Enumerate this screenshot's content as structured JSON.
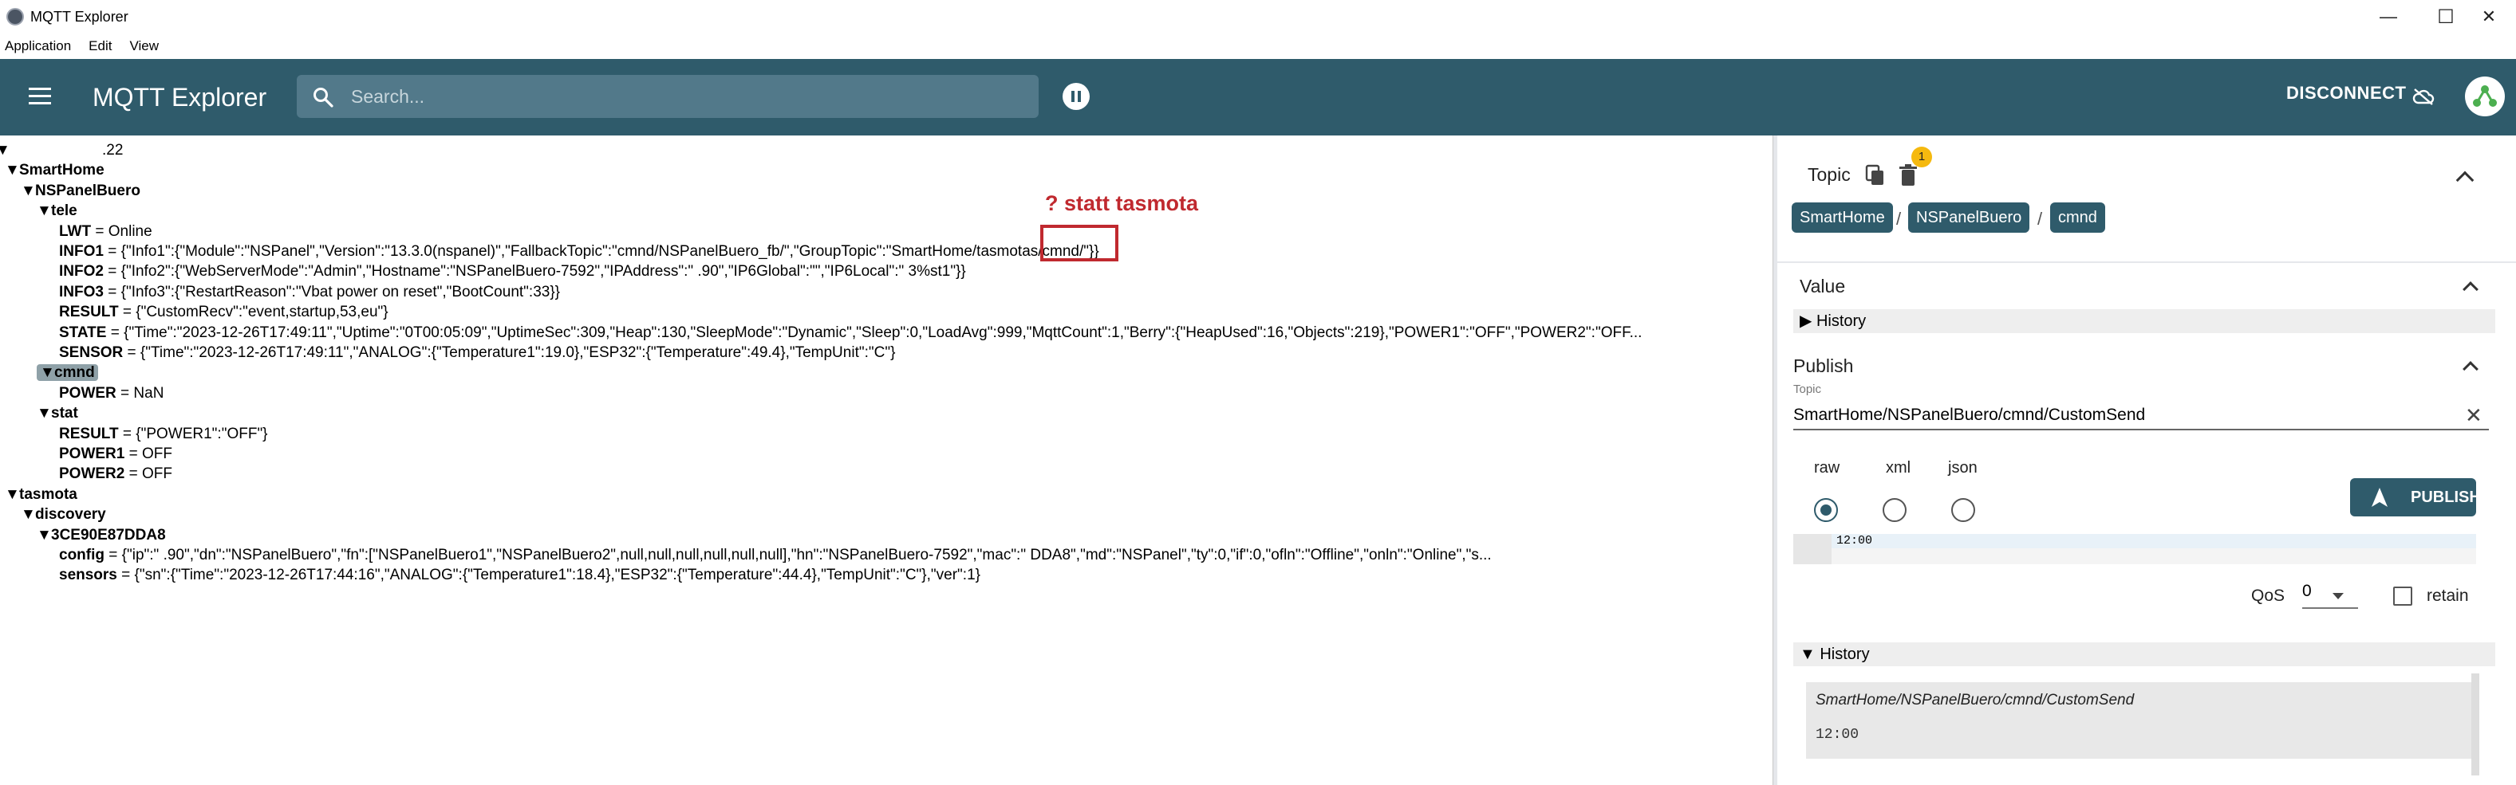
{
  "window": {
    "title": "MQTT Explorer",
    "minimize_glyph": "—",
    "maximize_glyph": "☐",
    "close_glyph": "✕"
  },
  "menu": [
    "Application",
    "Edit",
    "View"
  ],
  "header": {
    "title": "MQTT Explorer",
    "search_placeholder": "Search...",
    "disconnect_label": "DISCONNECT"
  },
  "tree": {
    "root_suffix": ".22",
    "rows": [
      {
        "indent": 0,
        "expand": "▼",
        "key": "",
        "value": ".22",
        "redact_before": true
      },
      {
        "indent": 1,
        "expand": "▼",
        "key": "SmartHome",
        "value": ""
      },
      {
        "indent": 2,
        "expand": "▼",
        "key": "NSPanelBuero",
        "value": ""
      },
      {
        "indent": 3,
        "expand": "▼",
        "key": "tele",
        "value": ""
      },
      {
        "indent": 4,
        "expand": "",
        "key": "LWT",
        "value": " = Online"
      },
      {
        "indent": 4,
        "expand": "",
        "key": "INFO1",
        "value": " = {\"Info1\":{\"Module\":\"NSPanel\",\"Version\":\"13.3.0(nspanel)\",\"FallbackTopic\":\"cmnd/NSPanelBuero_fb/\",\"GroupTopic\":\"SmartHome/tasmotas/cmnd/\"}}"
      },
      {
        "indent": 4,
        "expand": "",
        "key": "INFO2",
        "value": " = {\"Info2\":{\"WebServerMode\":\"Admin\",\"Hostname\":\"NSPanelBuero-7592\",\"IPAddress\":\"                    .90\",\"IP6Global\":\"\",\"IP6Local\":\"                                    3%st1\"}}"
      },
      {
        "indent": 4,
        "expand": "",
        "key": "INFO3",
        "value": " = {\"Info3\":{\"RestartReason\":\"Vbat power on reset\",\"BootCount\":33}}"
      },
      {
        "indent": 4,
        "expand": "",
        "key": "RESULT",
        "value": " = {\"CustomRecv\":\"event,startup,53,eu\"}"
      },
      {
        "indent": 4,
        "expand": "",
        "key": "STATE",
        "value": " = {\"Time\":\"2023-12-26T17:49:11\",\"Uptime\":\"0T00:05:09\",\"UptimeSec\":309,\"Heap\":130,\"SleepMode\":\"Dynamic\",\"Sleep\":0,\"LoadAvg\":999,\"MqttCount\":1,\"Berry\":{\"HeapUsed\":16,\"Objects\":219},\"POWER1\":\"OFF\",\"POWER2\":\"OFF..."
      },
      {
        "indent": 4,
        "expand": "",
        "key": "SENSOR",
        "value": " = {\"Time\":\"2023-12-26T17:49:11\",\"ANALOG\":{\"Temperature1\":19.0},\"ESP32\":{\"Temperature\":49.4},\"TempUnit\":\"C\"}"
      },
      {
        "indent": 3,
        "expand": "▼",
        "key": "cmnd",
        "value": "",
        "selected": true
      },
      {
        "indent": 4,
        "expand": "",
        "key": "POWER",
        "value": " = NaN"
      },
      {
        "indent": 3,
        "expand": "▼",
        "key": "stat",
        "value": ""
      },
      {
        "indent": 4,
        "expand": "",
        "key": "RESULT",
        "value": " = {\"POWER1\":\"OFF\"}"
      },
      {
        "indent": 4,
        "expand": "",
        "key": "POWER1",
        "value": " = OFF"
      },
      {
        "indent": 4,
        "expand": "",
        "key": "POWER2",
        "value": " = OFF"
      },
      {
        "indent": 1,
        "expand": "▼",
        "key": "tasmota",
        "value": ""
      },
      {
        "indent": 2,
        "expand": "▼",
        "key": "discovery",
        "value": ""
      },
      {
        "indent": 3,
        "expand": "▼",
        "key": "3CE90E87DDA8",
        "value": ""
      },
      {
        "indent": 4,
        "expand": "",
        "key": "config",
        "value": " = {\"ip\":\"                    .90\",\"dn\":\"NSPanelBuero\",\"fn\":[\"NSPanelBuero1\",\"NSPanelBuero2\",null,null,null,null,null,null],\"hn\":\"NSPanelBuero-7592\",\"mac\":\"                 DDA8\",\"md\":\"NSPanel\",\"ty\":0,\"if\":0,\"ofln\":\"Offline\",\"onln\":\"Online\",\"s..."
      },
      {
        "indent": 4,
        "expand": "",
        "key": "sensors",
        "value": " = {\"sn\":{\"Time\":\"2023-12-26T17:44:16\",\"ANALOG\":{\"Temperature1\":18.4},\"ESP32\":{\"Temperature\":44.4},\"TempUnit\":\"C\"},\"ver\":1}"
      }
    ]
  },
  "annotation": {
    "text": "? statt tasmota"
  },
  "topic_panel": {
    "title": "Topic",
    "badge_count": "1",
    "breadcrumb": [
      "SmartHome",
      "NSPanelBuero",
      "cmnd"
    ],
    "separator": "/"
  },
  "value_panel": {
    "title": "Value",
    "history_label": "History",
    "history_expand": "▶"
  },
  "publish_panel": {
    "title": "Publish",
    "topic_label": "Topic",
    "topic_value": "SmartHome/NSPanelBuero/cmnd/CustomSend",
    "clear_glyph": "✕",
    "formats": [
      "raw",
      "xml",
      "json"
    ],
    "selected_format": "raw",
    "publish_label": "PUBLISH",
    "editor_text": "12:00",
    "qos_label": "QoS",
    "qos_value": "0",
    "retain_label": "retain",
    "history_label": "History",
    "history_expand": "▼",
    "history_items": [
      {
        "topic": "SmartHome/NSPanelBuero/cmnd/CustomSend",
        "value": "12:00"
      }
    ]
  },
  "colors": {
    "header_bg": "#2f5b6b",
    "search_bg": "#52798a",
    "badge": "#f5b90f",
    "annotation": "#c0292f",
    "selected_bg": "#8fa1a8"
  }
}
